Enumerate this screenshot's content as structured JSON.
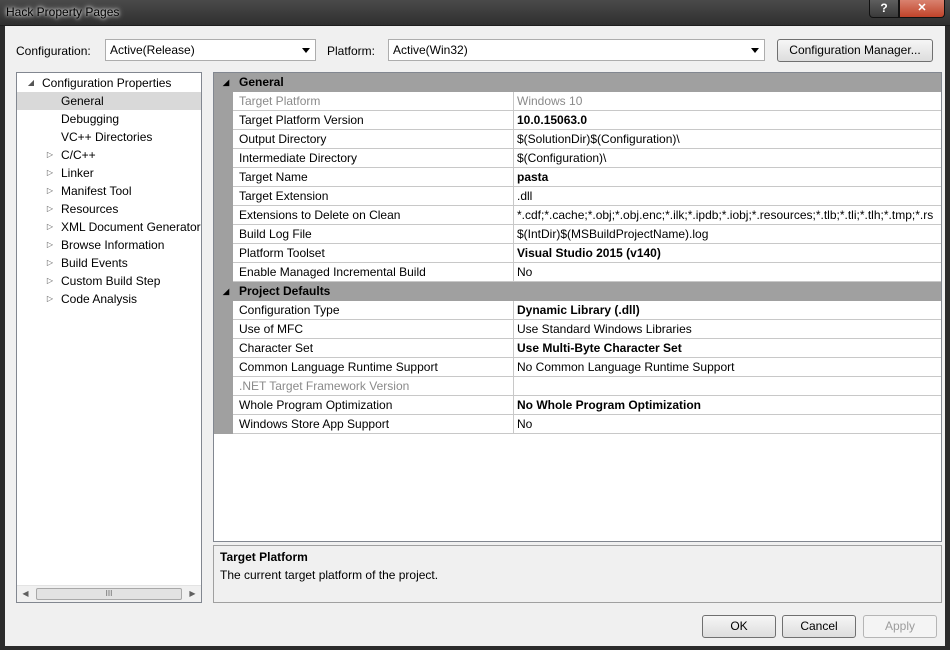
{
  "window": {
    "title": "Hack Property Pages",
    "help_glyph": "?",
    "close_glyph": "✕"
  },
  "config": {
    "label": "Configuration:",
    "value": "Active(Release)"
  },
  "platform": {
    "label": "Platform:",
    "value": "Active(Win32)"
  },
  "config_manager_label": "Configuration Manager...",
  "tree": {
    "root": "Configuration Properties",
    "items": [
      "General",
      "Debugging",
      "VC++ Directories",
      "C/C++",
      "Linker",
      "Manifest Tool",
      "Resources",
      "XML Document Generator",
      "Browse Information",
      "Build Events",
      "Custom Build Step",
      "Code Analysis"
    ],
    "scroll_thumb_glyph": "III"
  },
  "grid": {
    "categories": [
      "General",
      "Project Defaults"
    ],
    "general": [
      {
        "name": "Target Platform",
        "value": "Windows 10"
      },
      {
        "name": "Target Platform Version",
        "value": "10.0.15063.0"
      },
      {
        "name": "Output Directory",
        "value": "$(SolutionDir)$(Configuration)\\"
      },
      {
        "name": "Intermediate Directory",
        "value": "$(Configuration)\\"
      },
      {
        "name": "Target Name",
        "value": "pasta"
      },
      {
        "name": "Target Extension",
        "value": ".dll"
      },
      {
        "name": "Extensions to Delete on Clean",
        "value": "*.cdf;*.cache;*.obj;*.obj.enc;*.ilk;*.ipdb;*.iobj;*.resources;*.tlb;*.tli;*.tlh;*.tmp;*.rs"
      },
      {
        "name": "Build Log File",
        "value": "$(IntDir)$(MSBuildProjectName).log"
      },
      {
        "name": "Platform Toolset",
        "value": "Visual Studio 2015 (v140)"
      },
      {
        "name": "Enable Managed Incremental Build",
        "value": "No"
      }
    ],
    "defaults": [
      {
        "name": "Configuration Type",
        "value": "Dynamic Library (.dll)"
      },
      {
        "name": "Use of MFC",
        "value": "Use Standard Windows Libraries"
      },
      {
        "name": "Character Set",
        "value": "Use Multi-Byte Character Set"
      },
      {
        "name": "Common Language Runtime Support",
        "value": "No Common Language Runtime Support"
      },
      {
        "name": ".NET Target Framework Version",
        "value": ""
      },
      {
        "name": "Whole Program Optimization",
        "value": "No Whole Program Optimization"
      },
      {
        "name": "Windows Store App Support",
        "value": "No"
      }
    ]
  },
  "description": {
    "title": "Target Platform",
    "text": "The current target platform of the project."
  },
  "buttons": {
    "ok": "OK",
    "cancel": "Cancel",
    "apply": "Apply"
  }
}
